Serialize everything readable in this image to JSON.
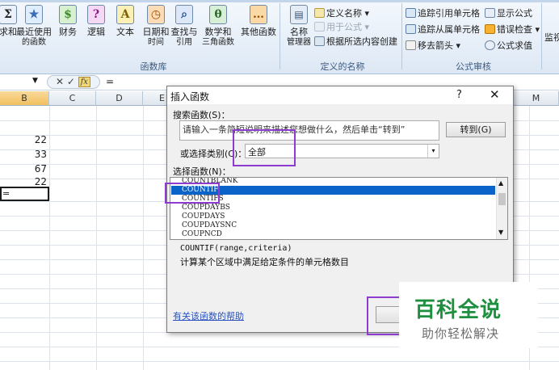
{
  "ribbon": {
    "buttons": [
      {
        "l1": "求和",
        "l2": "",
        "icon": "sigma-icon",
        "glyph": "Σ"
      },
      {
        "l1": "最近使用",
        "l2": "的函数",
        "icon": "recent-icon",
        "glyph": "★"
      },
      {
        "l1": "财务",
        "l2": "",
        "icon": "finance-icon",
        "glyph": "$"
      },
      {
        "l1": "逻辑",
        "l2": "",
        "icon": "logic-icon",
        "glyph": "?"
      },
      {
        "l1": "文本",
        "l2": "",
        "icon": "text-icon",
        "glyph": "A"
      },
      {
        "l1": "日期和",
        "l2": "时间",
        "icon": "datetime-icon",
        "glyph": "◷"
      },
      {
        "l1": "查找与",
        "l2": "引用",
        "icon": "lookup-icon",
        "glyph": "⌕"
      },
      {
        "l1": "数学和",
        "l2": "三角函数",
        "icon": "math-icon",
        "glyph": "θ"
      },
      {
        "l1": "其他函数",
        "l2": "",
        "icon": "more-functions-icon",
        "glyph": "…"
      }
    ],
    "group_function_library": "函数库",
    "name_manager_l1": "名称",
    "name_manager_l2": "管理器",
    "define_name": "定义名称",
    "use_in_formula": "用于公式",
    "create_from_selection": "根据所选内容创建",
    "group_defined_names": "定义的名称",
    "trace_precedents": "追踪引用单元格",
    "trace_dependents": "追踪从属单元格",
    "remove_arrows": "移去箭头",
    "show_formulas": "显示公式",
    "error_checking": "错误检查",
    "evaluate_formula": "公式求值",
    "watch_window": "监视",
    "group_formula_auditing": "公式审核",
    "colors": {
      "accent": "#0a63c9",
      "highlight": "#8e3ccf",
      "brand_green": "#1e8f3e"
    }
  },
  "formula_bar": {
    "value": "=",
    "fx": "fx",
    "cancel": "✕",
    "enter": "✓"
  },
  "columns": [
    "B",
    "C",
    "D",
    "E",
    "M"
  ],
  "cells": [
    "22",
    "33",
    "67",
    "22"
  ],
  "active_cell_value": "=",
  "dialog": {
    "title": "插入函数",
    "help_glyph": "?",
    "close_glyph": "✕",
    "search_label": "搜索函数(S)：",
    "search_value": "请输入一条简短说明来描述您想做什么，然后单击“转到”",
    "go_button": "转到(G)",
    "category_label": "或选择类别(C)：",
    "category_value": "全部",
    "select_label": "选择函数(N)：",
    "functions": [
      "COUNTBLANK",
      "COUNTIF",
      "COUNTIFS",
      "COUPDAYBS",
      "COUPDAYS",
      "COUPDAYSNC",
      "COUPNCD"
    ],
    "selected_function": "COUNTIF",
    "syntax": "COUNTIF(range,criteria)",
    "description": "计算某个区域中满足给定条件的单元格数目",
    "help_link": "有关该函数的帮助"
  },
  "watermark": {
    "title": "百科全说",
    "subtitle": "助你轻松解决"
  }
}
